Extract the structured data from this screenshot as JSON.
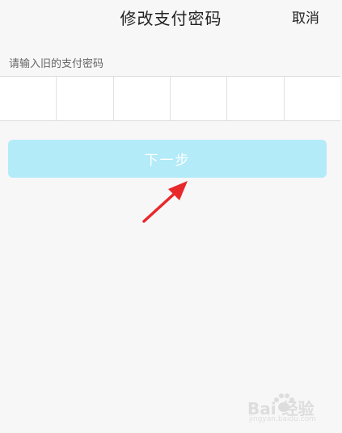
{
  "header": {
    "title": "修改支付密码",
    "cancel_label": "取消"
  },
  "form": {
    "hint": "请输入旧的支付密码",
    "pin_cells": [
      "",
      "",
      "",
      "",
      "",
      ""
    ]
  },
  "actions": {
    "next_label": "下一步"
  },
  "watermark": {
    "brand": "Bai 经验",
    "sub": "jingyan.baidu.com"
  },
  "colors": {
    "button_bg": "#b3ebf9",
    "arrow": "#e8282b",
    "background": "#f7f7f7"
  },
  "annotation": {
    "icon": "red-arrow-icon"
  }
}
